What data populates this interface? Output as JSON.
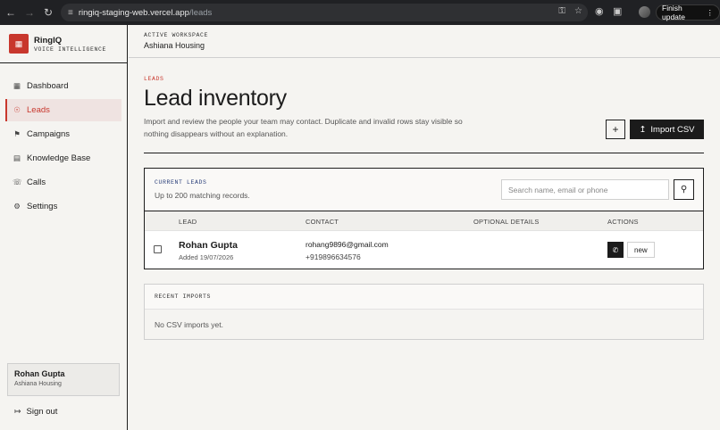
{
  "browser": {
    "url_host": "ringiq-staging-web.vercel.app",
    "url_path": "/leads",
    "finish_update_label": "Finish update"
  },
  "brand": {
    "name": "RingIQ",
    "tagline": "VOICE INTELLIGENCE"
  },
  "sidebar": {
    "items": [
      {
        "label": "Dashboard",
        "icon": "grid-icon"
      },
      {
        "label": "Leads",
        "icon": "leads-icon",
        "active": true
      },
      {
        "label": "Campaigns",
        "icon": "megaphone-icon"
      },
      {
        "label": "Knowledge Base",
        "icon": "book-icon"
      },
      {
        "label": "Calls",
        "icon": "phone-icon"
      },
      {
        "label": "Settings",
        "icon": "gear-icon"
      }
    ],
    "user": {
      "name": "Rohan Gupta",
      "org": "Ashiana Housing"
    },
    "sign_out_label": "Sign out"
  },
  "topbar": {
    "workspace_label": "ACTIVE WORKSPACE",
    "workspace_name": "Ashiana Housing"
  },
  "page": {
    "eyebrow": "LEADS",
    "title": "Lead inventory",
    "description": "Import and review the people your team may contact. Duplicate and invalid rows stay visible so nothing disappears without an explanation.",
    "add_label": "+",
    "import_label": "Import CSV"
  },
  "leads_panel": {
    "label": "CURRENT LEADS",
    "subtitle": "Up to 200 matching records.",
    "search_placeholder": "Search name, email or phone",
    "columns": [
      "LEAD",
      "CONTACT",
      "OPTIONAL DETAILS",
      "ACTIONS"
    ],
    "rows": [
      {
        "name": "Rohan Gupta",
        "added": "Added 19/07/2026",
        "email": "rohang9896@gmail.com",
        "phone": "+919896634576",
        "optional": "",
        "status": "new"
      }
    ]
  },
  "imports_panel": {
    "label": "RECENT IMPORTS",
    "empty_text": "No CSV imports yet."
  },
  "colors": {
    "accent": "#c8372d",
    "dark": "#1b1b1b",
    "background": "#f5f4f1"
  }
}
